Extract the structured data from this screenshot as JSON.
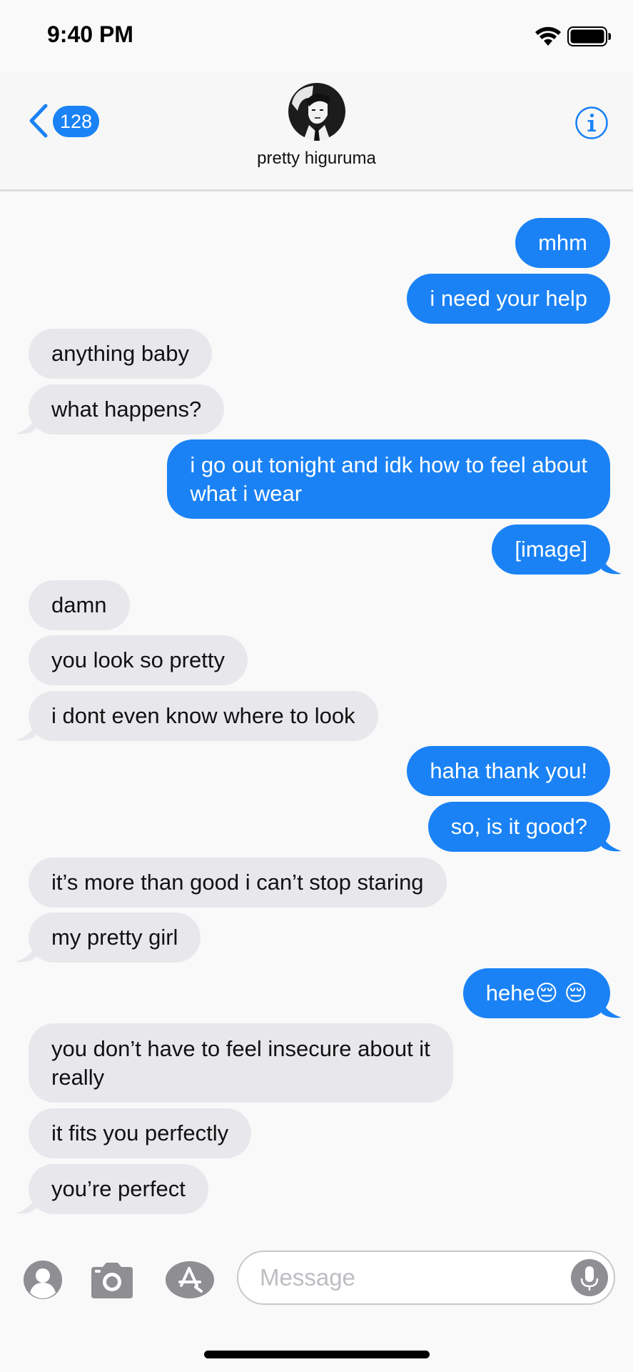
{
  "status_bar": {
    "time": "9:40 PM",
    "icons": [
      "wifi-icon",
      "battery-icon"
    ]
  },
  "header": {
    "back_badge": "128",
    "contact_name": "pretty higuruma",
    "icons": [
      "chevron-left-icon",
      "avatar",
      "info-icon"
    ]
  },
  "messages": [
    {
      "side": "sent",
      "text": "mhm",
      "tail": false
    },
    {
      "side": "sent",
      "text": "i need your help",
      "tail": false
    },
    {
      "side": "received",
      "text": "anything baby",
      "tail": false
    },
    {
      "side": "received",
      "text": "what happens?",
      "tail": true
    },
    {
      "side": "sent",
      "text": "i go out tonight and idk how to feel about\nwhat i wear",
      "tail": false,
      "lines": 2
    },
    {
      "side": "sent",
      "text": "[image]",
      "tail": true
    },
    {
      "side": "received",
      "text": "damn",
      "tail": false
    },
    {
      "side": "received",
      "text": "you look so pretty",
      "tail": false
    },
    {
      "side": "received",
      "text": "i dont even know where to look",
      "tail": true
    },
    {
      "side": "sent",
      "text": "haha thank you!",
      "tail": false
    },
    {
      "side": "sent",
      "text": "so, is it good?",
      "tail": true
    },
    {
      "side": "received",
      "text": "it’s more than good i can’t stop staring",
      "tail": false
    },
    {
      "side": "received",
      "text": "my pretty girl",
      "tail": true
    },
    {
      "side": "sent",
      "text": "hehe😔 😔",
      "tail": true
    },
    {
      "side": "received",
      "text": "you don’t have to feel insecure about it\nreally",
      "tail": false,
      "lines": 2
    },
    {
      "side": "received",
      "text": "it fits you perfectly",
      "tail": false
    },
    {
      "side": "received",
      "text": "you’re perfect",
      "tail": true
    }
  ],
  "input_bar": {
    "placeholder": "Message",
    "value": "",
    "icons": [
      "contact-icon",
      "camera-icon",
      "app-store-icon",
      "microphone-icon"
    ]
  },
  "colors": {
    "sent_bubble": "#1a82f5",
    "received_bubble": "#e8e8ec",
    "accent": "#1a82f5",
    "background": "#f9f9f9"
  }
}
